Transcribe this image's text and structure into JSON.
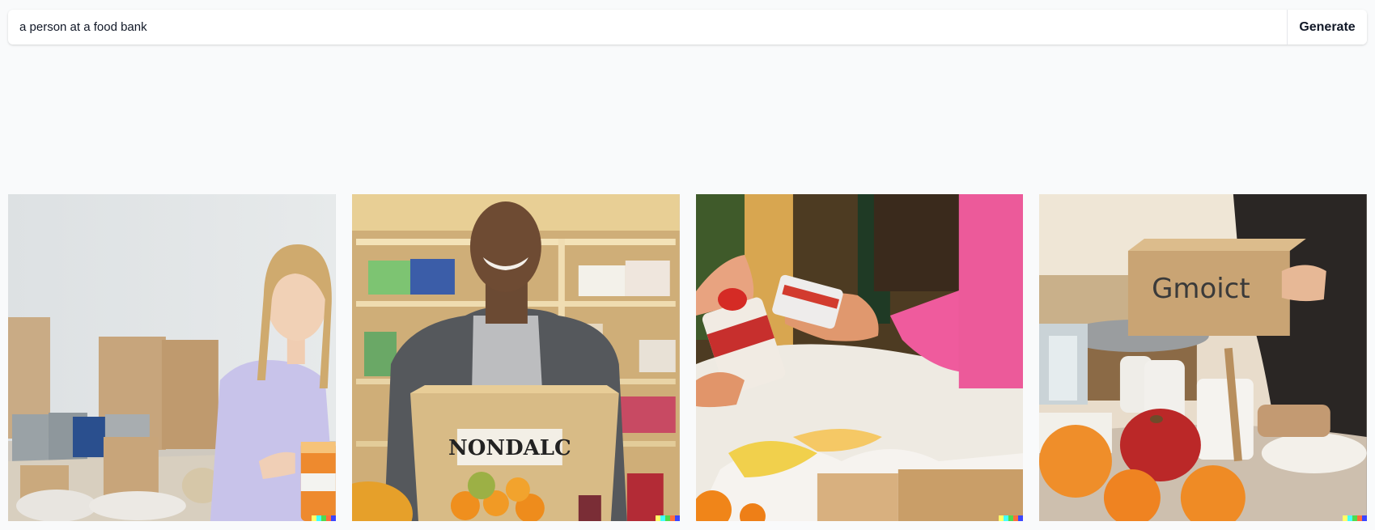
{
  "prompt": {
    "value": "a person at a food bank",
    "placeholder": "",
    "generate_label": "Generate"
  },
  "images": [
    {
      "name": "Woman packing canned goods",
      "signature_colors": [
        "#ffff66",
        "#42ffff",
        "#51da4c",
        "#ff6e3c",
        "#3c46ff"
      ]
    },
    {
      "name": "Man with donation box",
      "box_label": "NONDALC",
      "signature_colors": [
        "#ffff66",
        "#42ffff",
        "#51da4c",
        "#ff6e3c",
        "#3c46ff"
      ]
    },
    {
      "name": "Hands sorting food items",
      "signature_colors": [
        "#ffff66",
        "#42ffff",
        "#51da4c",
        "#ff6e3c",
        "#3c46ff"
      ]
    },
    {
      "name": "Person holding cardboard box",
      "box_label": "Gmoict",
      "signature_colors": [
        "#ffff66",
        "#42ffff",
        "#51da4c",
        "#ff6e3c",
        "#3c46ff"
      ]
    }
  ]
}
